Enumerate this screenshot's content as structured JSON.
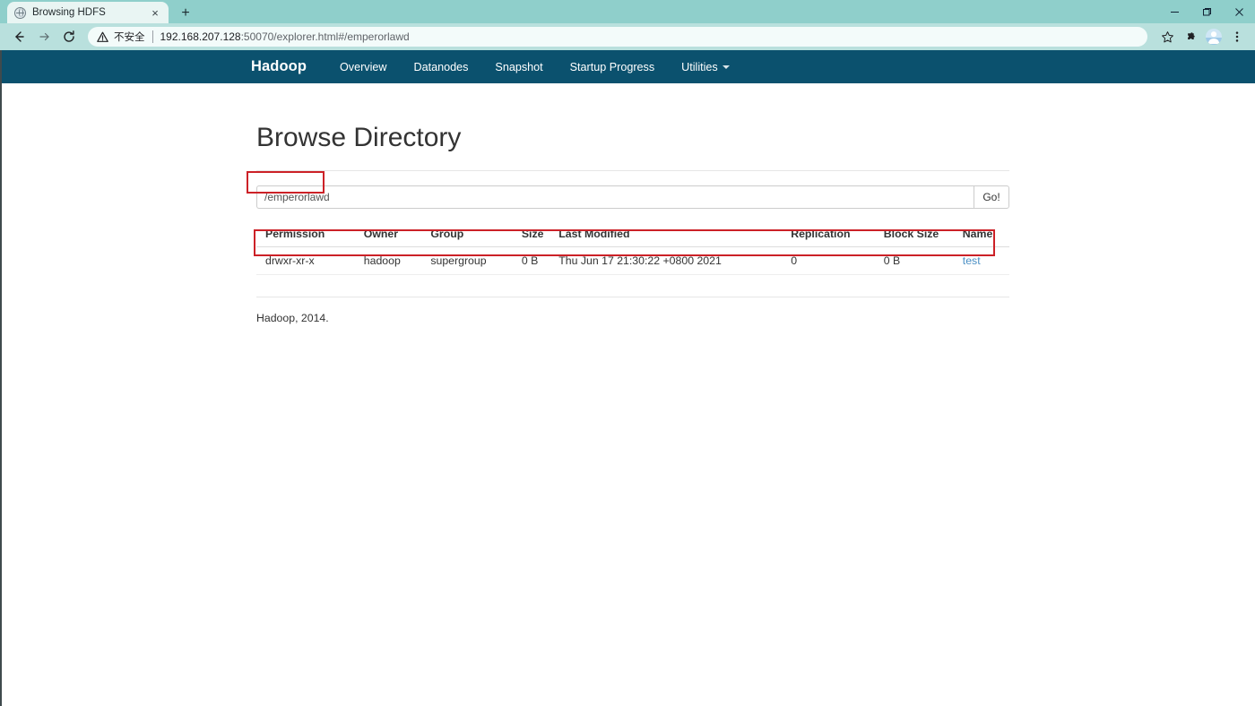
{
  "browser": {
    "tab": {
      "title": "Browsing HDFS",
      "favicon": "globe-icon",
      "close": "×"
    },
    "new_tab_label": "+",
    "window_controls": {
      "minimize": "minimize-icon",
      "maximize": "maximize-icon",
      "close": "close-icon"
    },
    "toolbar": {
      "back": "back-arrow-icon",
      "forward": "forward-arrow-icon",
      "reload": "reload-icon",
      "security_label": "不安全",
      "url_host": "192.168.207.128",
      "url_rest": ":50070/explorer.html#/emperorlawd",
      "bookmark": "star-icon",
      "extensions": "puzzle-icon",
      "profile": "avatar-icon",
      "menu": "three-dot-menu-icon"
    }
  },
  "hadoop_nav": {
    "brand": "Hadoop",
    "items": [
      {
        "label": "Overview",
        "has_caret": false
      },
      {
        "label": "Datanodes",
        "has_caret": false
      },
      {
        "label": "Snapshot",
        "has_caret": false
      },
      {
        "label": "Startup Progress",
        "has_caret": false
      },
      {
        "label": "Utilities",
        "has_caret": true
      }
    ]
  },
  "page": {
    "title": "Browse Directory",
    "path_input": {
      "value": "/emperorlawd",
      "placeholder": ""
    },
    "go_button": "Go!",
    "table": {
      "headers": [
        "Permission",
        "Owner",
        "Group",
        "Size",
        "Last Modified",
        "Replication",
        "Block Size",
        "Name"
      ],
      "rows": [
        {
          "permission": "drwxr-xr-x",
          "owner": "hadoop",
          "group": "supergroup",
          "size": "0 B",
          "last_modified": "Thu Jun 17 21:30:22 +0800 2021",
          "replication": "0",
          "block_size": "0 B",
          "name": "test"
        }
      ]
    },
    "footer": "Hadoop, 2014."
  },
  "annotations": {
    "color": "#cc2127",
    "boxes": [
      {
        "target": "path-input"
      },
      {
        "target": "table-row"
      }
    ]
  },
  "colors": {
    "nav_bg": "#0b516e",
    "tabstrip_bg": "#8fcfcb",
    "toolbar_bg": "#b9e0dd",
    "link": "#4a8fc4",
    "annotation": "#cc2127"
  }
}
